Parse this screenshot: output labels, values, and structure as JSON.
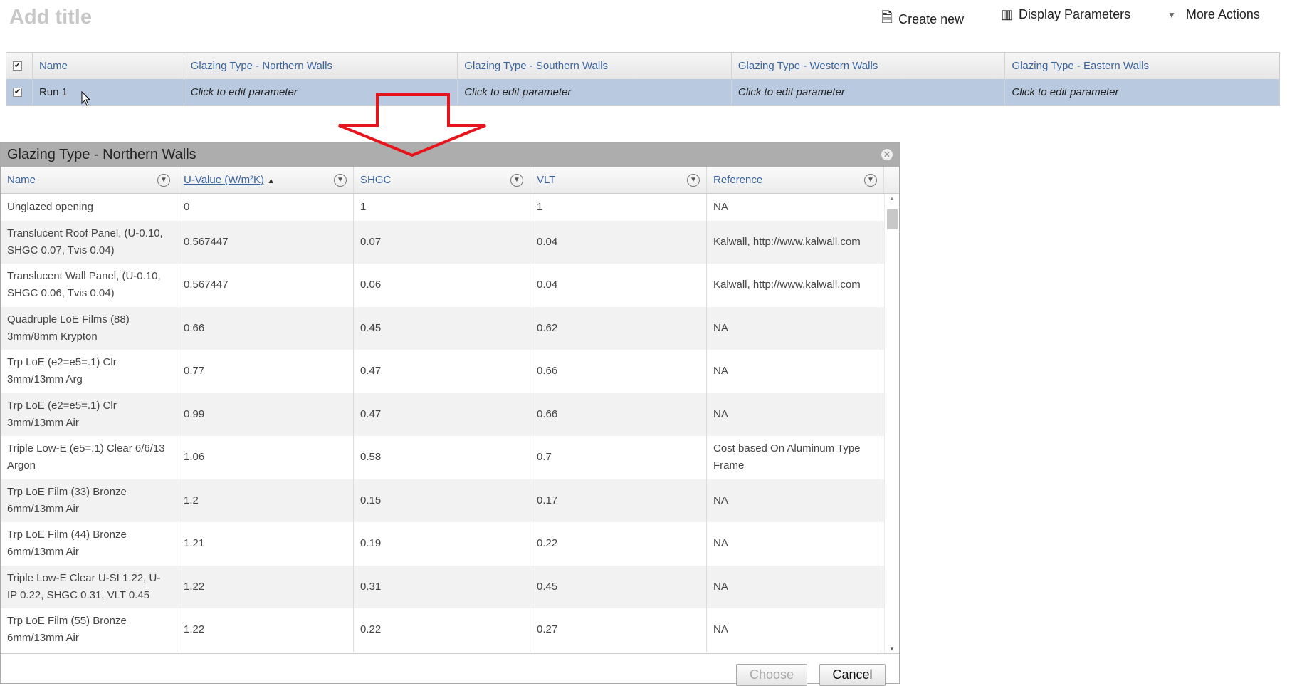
{
  "page": {
    "title": "Add title"
  },
  "toolbar": {
    "create_new": "Create new",
    "display_parameters": "Display Parameters",
    "more_actions": "More Actions"
  },
  "grid": {
    "headers": [
      "Name",
      "Glazing Type - Northern Walls",
      "Glazing Type - Southern Walls",
      "Glazing Type - Western Walls",
      "Glazing Type - Eastern Walls"
    ],
    "row": {
      "name": "Run 1",
      "cells": [
        "Click to edit parameter",
        "Click to edit parameter",
        "Click to edit parameter",
        "Click to edit parameter"
      ]
    }
  },
  "dialog": {
    "title": "Glazing Type - Northern Walls",
    "columns": [
      "Name",
      "U-Value (W/m²K)",
      "SHGC",
      "VLT",
      "Reference"
    ],
    "sort_indicator": "▲",
    "rows": [
      [
        "Unglazed opening",
        "0",
        "1",
        "1",
        "NA"
      ],
      [
        "Translucent Roof Panel, (U-0.10, SHGC 0.07, Tvis 0.04)",
        "0.567447",
        "0.07",
        "0.04",
        "Kalwall, http://www.kalwall.com"
      ],
      [
        "Translucent Wall Panel, (U-0.10, SHGC 0.06, Tvis 0.04)",
        "0.567447",
        "0.06",
        "0.04",
        "Kalwall, http://www.kalwall.com"
      ],
      [
        "Quadruple LoE Films (88) 3mm/8mm Krypton",
        "0.66",
        "0.45",
        "0.62",
        "NA"
      ],
      [
        "Trp LoE (e2=e5=.1) Clr 3mm/13mm Arg",
        "0.77",
        "0.47",
        "0.66",
        "NA"
      ],
      [
        "Trp LoE (e2=e5=.1) Clr 3mm/13mm Air",
        "0.99",
        "0.47",
        "0.66",
        "NA"
      ],
      [
        "Triple Low-E (e5=.1) Clear 6/6/13 Argon",
        "1.06",
        "0.58",
        "0.7",
        "Cost based On Aluminum Type Frame"
      ],
      [
        "Trp LoE Film (33) Bronze 6mm/13mm Air",
        "1.2",
        "0.15",
        "0.17",
        "NA"
      ],
      [
        "Trp LoE Film (44) Bronze 6mm/13mm Air",
        "1.21",
        "0.19",
        "0.22",
        "NA"
      ],
      [
        "Triple Low-E Clear U-SI 1.22, U-IP 0.22, SHGC 0.31, VLT 0.45",
        "1.22",
        "0.31",
        "0.45",
        "NA"
      ],
      [
        "Trp LoE Film (55) Bronze 6mm/13mm Air",
        "1.22",
        "0.22",
        "0.27",
        "NA"
      ]
    ],
    "choose": "Choose",
    "cancel": "Cancel"
  },
  "colors": {
    "arrow": "#e8141c",
    "selected_row": "#b8c9e0",
    "dialog_title_bg": "#adadad"
  }
}
